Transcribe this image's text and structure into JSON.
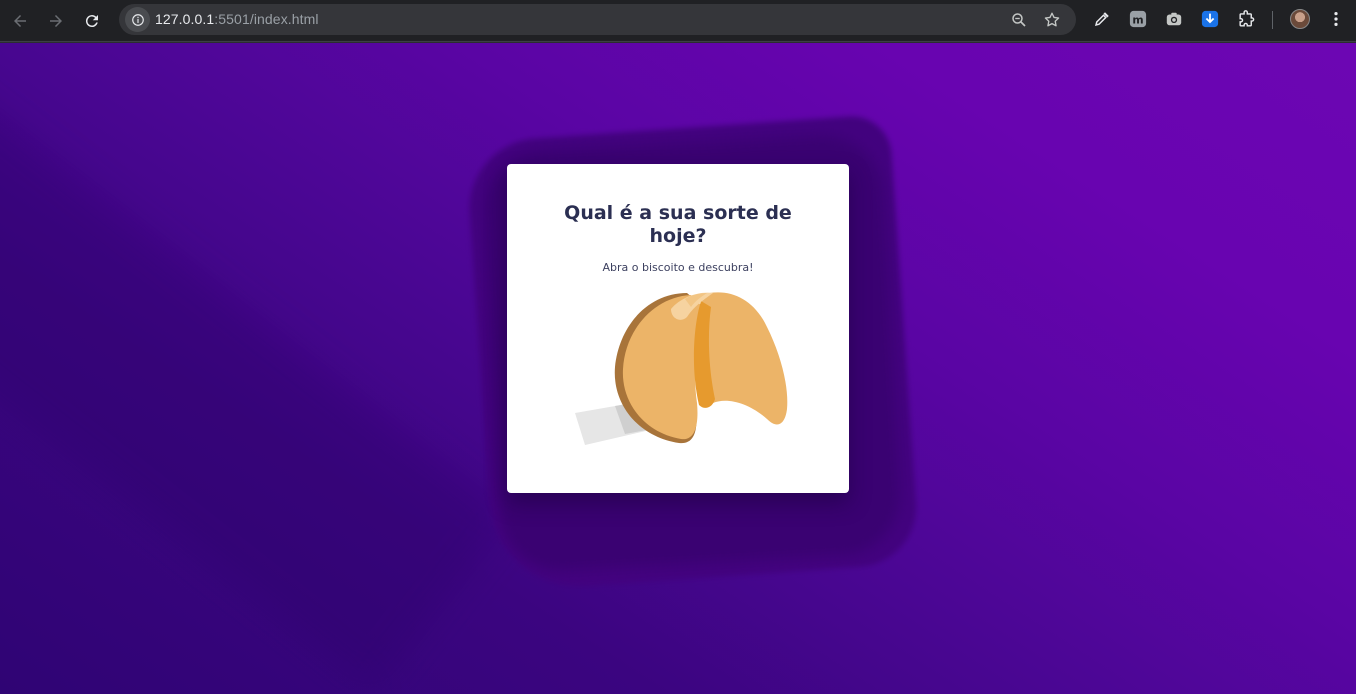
{
  "browser": {
    "url_host": "127.0.0.1",
    "url_path": ":5501/index.html",
    "icons": [
      "back-arrow-icon",
      "forward-arrow-icon",
      "reload-icon",
      "site-info-icon",
      "zoom-icon",
      "bookmark-star-icon",
      "eyedropper-icon",
      "m-extension-icon",
      "camera-extension-icon",
      "download-extension-icon",
      "puzzle-extensions-icon",
      "profile-avatar",
      "kebab-menu-icon"
    ]
  },
  "card": {
    "title": "Qual é a sua sorte de hoje?",
    "subtitle": "Abra o biscoito e descubra!"
  },
  "colors": {
    "background_start": "#2f0474",
    "background_end": "#6c06b3",
    "title": "#2b2f52",
    "cookie": "#ecb468"
  }
}
